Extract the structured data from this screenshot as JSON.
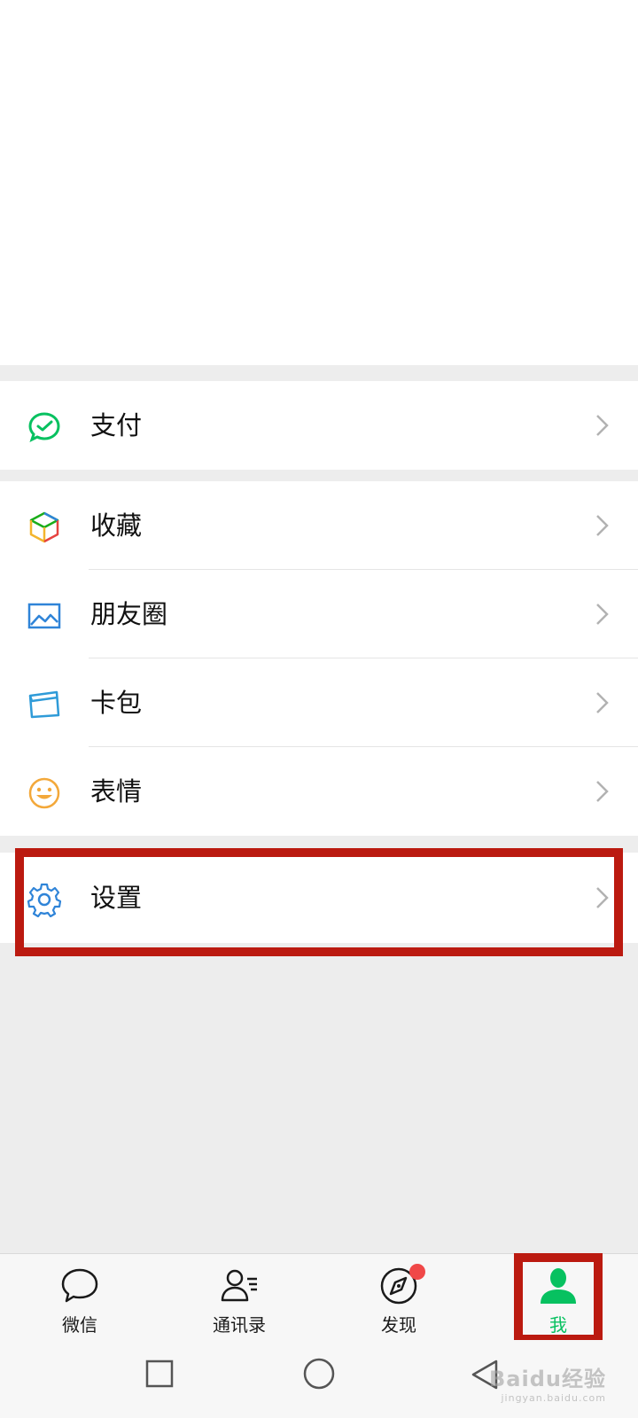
{
  "menu": {
    "pay": {
      "label": "支付",
      "icon": "pay-icon"
    },
    "favorites": {
      "label": "收藏",
      "icon": "favorites-cube-icon"
    },
    "moments": {
      "label": "朋友圈",
      "icon": "moments-image-icon"
    },
    "cards": {
      "label": "卡包",
      "icon": "card-wallet-icon"
    },
    "stickers": {
      "label": "表情",
      "icon": "smiley-icon"
    },
    "settings": {
      "label": "设置",
      "icon": "gear-icon"
    }
  },
  "tabs": [
    {
      "label": "微信",
      "icon": "chat-bubble-icon"
    },
    {
      "label": "通讯录",
      "icon": "contacts-icon"
    },
    {
      "label": "发现",
      "icon": "compass-icon",
      "badge": "red-dot"
    },
    {
      "label": "我",
      "icon": "person-icon",
      "active": true
    }
  ],
  "colors": {
    "accent": "#07c160",
    "highlight": "#bb1a10",
    "badge": "#f04848"
  },
  "watermark": {
    "brand": "Baidu经验",
    "url": "jingyan.baidu.com"
  }
}
